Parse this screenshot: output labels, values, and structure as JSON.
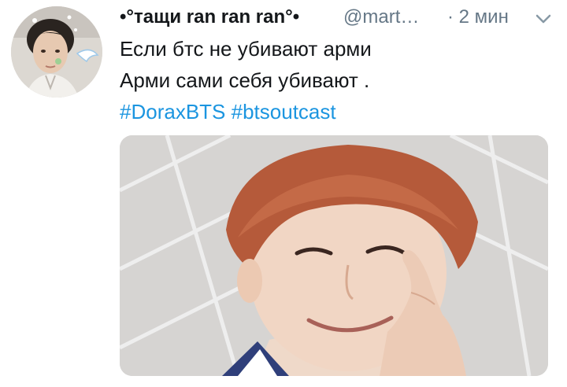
{
  "tweet": {
    "author": {
      "display_name": "•°тащи ran ran ran°•",
      "handle": "@mart…",
      "avatar_icon": "user-avatar-photo"
    },
    "timestamp": "· 2 мин",
    "menu_icon": "chevron-down-icon",
    "text_lines": [
      "Если бтс не убивают  арми",
      "Арми сами себя убивают ."
    ],
    "hashtags": [
      "#DoraxBTS",
      "#btsoutcast"
    ],
    "media": {
      "kind": "photo"
    }
  },
  "colors": {
    "link": "#1b95e0",
    "secondary_text": "#657786",
    "primary_text": "#14171a"
  }
}
